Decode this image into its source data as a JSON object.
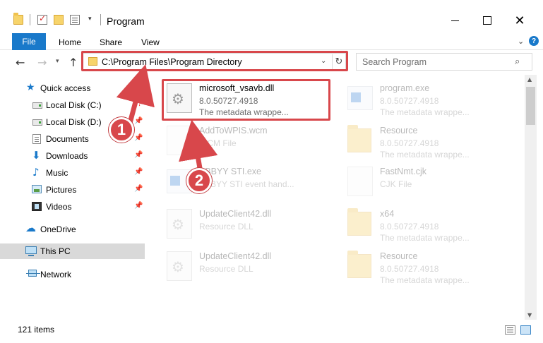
{
  "window": {
    "title": "Program",
    "quick_access_dropdown": "▾",
    "minimize_label": "",
    "close_label": "✕"
  },
  "ribbon": {
    "tabs": [
      "File",
      "Home",
      "Share",
      "View"
    ],
    "expand_glyph": "⌄",
    "help_glyph": "?"
  },
  "nav": {
    "back_glyph": "←",
    "forward_glyph": "→",
    "recent_glyph": "▾",
    "up_glyph": "↑",
    "address": "C:\\Program Files\\Program Directory",
    "address_dropdown": "⌄",
    "refresh_glyph": "↻",
    "search_placeholder": "Search Program",
    "search_glyph": "⌕"
  },
  "sidebar": {
    "items": [
      {
        "label": "Quick access",
        "icon": "star-icon",
        "glyph": "★",
        "pinned": false,
        "selected": false
      },
      {
        "label": "Local Disk (C:)",
        "icon": "disk-icon",
        "pinned": true,
        "selected": false
      },
      {
        "label": "Local Disk (D:)",
        "icon": "disk-icon",
        "pinned": true,
        "selected": false
      },
      {
        "label": "Documents",
        "icon": "documents-icon",
        "pinned": true,
        "selected": false
      },
      {
        "label": "Downloads",
        "icon": "download-icon",
        "glyph": "⬇",
        "pinned": true,
        "selected": false
      },
      {
        "label": "Music",
        "icon": "music-icon",
        "glyph": "♪",
        "pinned": true,
        "selected": false
      },
      {
        "label": "Pictures",
        "icon": "pictures-icon",
        "pinned": true,
        "selected": false
      },
      {
        "label": "Videos",
        "icon": "videos-icon",
        "pinned": true,
        "selected": false
      },
      {
        "label": "OneDrive",
        "icon": "cloud-icon",
        "glyph": "☁",
        "pinned": false,
        "selected": false
      },
      {
        "label": "This PC",
        "icon": "computer-icon",
        "pinned": false,
        "selected": true
      },
      {
        "label": "Network",
        "icon": "network-icon",
        "pinned": false,
        "selected": false
      }
    ],
    "pin_glyph": "📌"
  },
  "files": [
    {
      "name": "microsoft_vsavb.dll",
      "meta1": "8.0.50727.4918",
      "meta2": "The metadata wrappe...",
      "icon": "dll-file-icon",
      "highlighted": true
    },
    {
      "name": "program.exe",
      "meta1": "8.0.50727.4918",
      "meta2": "The metadata wrappe...",
      "icon": "exe-file-icon",
      "highlighted": false
    },
    {
      "name": "AddToWPIS.wcm",
      "meta1": "WCM File",
      "meta2": "",
      "icon": "blank-file-icon",
      "highlighted": false
    },
    {
      "name": "Resource",
      "meta1": "8.0.50727.4918",
      "meta2": "The metadata wrappe...",
      "icon": "folder-icon",
      "highlighted": false
    },
    {
      "name": "ABBYY STI.exe",
      "meta1": "ABBYY STI event hand...",
      "meta2": "",
      "icon": "exe-file-icon",
      "highlighted": false
    },
    {
      "name": "FastNmt.cjk",
      "meta1": "CJK File",
      "meta2": "",
      "icon": "blank-file-icon",
      "highlighted": false
    },
    {
      "name": "UpdateClient42.dll",
      "meta1": "Resource DLL",
      "meta2": "",
      "icon": "dll-file-icon",
      "highlighted": false
    },
    {
      "name": "x64",
      "meta1": "8.0.50727.4918",
      "meta2": "The metadata wrappe...",
      "icon": "folder-icon",
      "highlighted": false
    },
    {
      "name": "UpdateClient42.dll",
      "meta1": "Resource DLL",
      "meta2": "",
      "icon": "dll-file-icon",
      "highlighted": false
    },
    {
      "name": "Resource",
      "meta1": "8.0.50727.4918",
      "meta2": "The metadata wrappe...",
      "icon": "folder-icon",
      "highlighted": false
    }
  ],
  "scrollbar": {
    "up_glyph": "▲",
    "down_glyph": "▼"
  },
  "status": {
    "item_count": "121 items"
  },
  "annotations": {
    "badge_1": "1",
    "badge_2": "2",
    "highlight_color": "#d8474b"
  },
  "colors": {
    "accent": "#1979ca",
    "selection": "#d9d9d9"
  }
}
